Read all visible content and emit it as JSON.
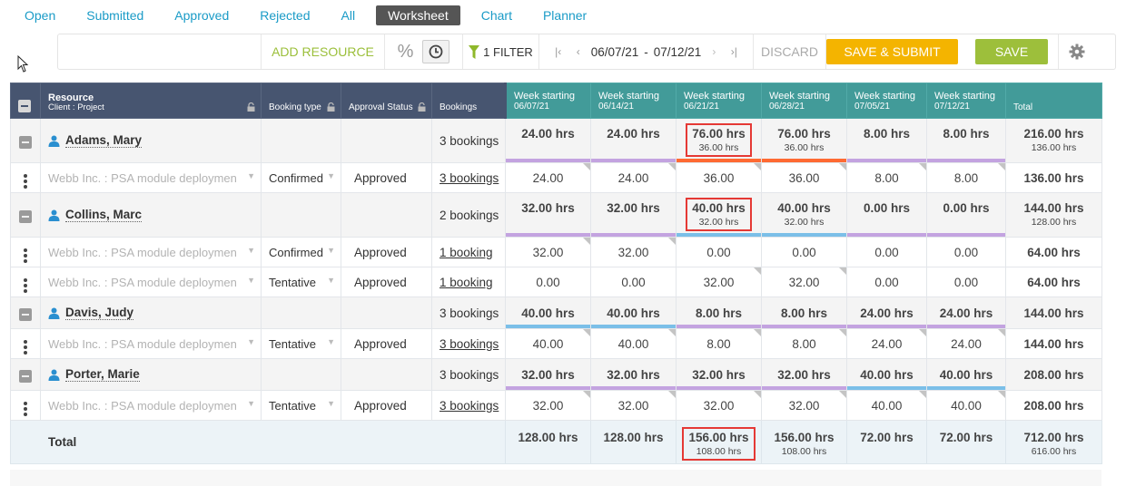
{
  "tabs": [
    {
      "label": "Open",
      "active": false
    },
    {
      "label": "Submitted",
      "active": false
    },
    {
      "label": "Approved",
      "active": false
    },
    {
      "label": "Rejected",
      "active": false
    },
    {
      "label": "All",
      "active": false
    },
    {
      "label": "Worksheet",
      "active": true
    },
    {
      "label": "Chart",
      "active": false
    },
    {
      "label": "Planner",
      "active": false
    }
  ],
  "toolbar": {
    "add_resource": "ADD RESOURCE",
    "percent_icon": "%",
    "clock_icon": "clock-icon",
    "filter_label": "1 FILTER",
    "date_from": "06/07/21",
    "date_sep": "-",
    "date_to": "07/12/21",
    "discard": "DISCARD",
    "save_submit": "SAVE & SUBMIT",
    "save": "SAVE",
    "settings_icon": "gear-icon"
  },
  "colors": {
    "header_dark": "#475570",
    "header_teal": "#429b99",
    "save_submit": "#f4b400",
    "save": "#9dbf3b",
    "bar_purple": "#c3a3e0",
    "bar_orange": "#ff6a33",
    "bar_blue": "#7bbfe8",
    "highlight": "#e53935"
  },
  "grid": {
    "headers": {
      "resource": "Resource",
      "client_project": "Client : Project",
      "booking_type": "Booking type",
      "approval_status": "Approval Status",
      "bookings": "Bookings",
      "week_label": "Week starting",
      "weeks": [
        "06/07/21",
        "06/14/21",
        "06/21/21",
        "06/28/21",
        "07/05/21",
        "07/12/21"
      ],
      "total": "Total"
    },
    "groups": [
      {
        "name": "Adams, Mary",
        "bookings": "3 bookings",
        "weeks": [
          {
            "value": "24.00 hrs",
            "sub": "",
            "bar": "purple"
          },
          {
            "value": "24.00 hrs",
            "sub": "",
            "bar": "purple"
          },
          {
            "value": "76.00 hrs",
            "sub": "36.00 hrs",
            "bar": "orange",
            "highlight": true
          },
          {
            "value": "76.00 hrs",
            "sub": "36.00 hrs",
            "bar": "orange"
          },
          {
            "value": "8.00 hrs",
            "sub": "",
            "bar": "purple"
          },
          {
            "value": "8.00 hrs",
            "sub": "",
            "bar": "purple"
          }
        ],
        "total": "216.00 hrs",
        "total_sub": "136.00 hrs",
        "rows": [
          {
            "project": "Webb Inc. : PSA module deploymen",
            "booking_type": "Confirmed",
            "approval": "Approved",
            "bookings": "3 bookings",
            "weeks": [
              "24.00",
              "24.00",
              "36.00",
              "36.00",
              "8.00",
              "8.00"
            ],
            "total": "136.00 hrs"
          }
        ]
      },
      {
        "name": "Collins, Marc",
        "bookings": "2 bookings",
        "weeks": [
          {
            "value": "32.00 hrs",
            "sub": "",
            "bar": "purple"
          },
          {
            "value": "32.00 hrs",
            "sub": "",
            "bar": "purple"
          },
          {
            "value": "40.00 hrs",
            "sub": "32.00 hrs",
            "bar": "blue",
            "highlight": true
          },
          {
            "value": "40.00 hrs",
            "sub": "32.00 hrs",
            "bar": "blue"
          },
          {
            "value": "0.00 hrs",
            "sub": "",
            "bar": "purple"
          },
          {
            "value": "0.00 hrs",
            "sub": "",
            "bar": "purple"
          }
        ],
        "total": "144.00 hrs",
        "total_sub": "128.00 hrs",
        "rows": [
          {
            "project": "Webb Inc. : PSA module deploymen",
            "booking_type": "Confirmed",
            "approval": "Approved",
            "bookings": "1 booking",
            "weeks": [
              "32.00",
              "32.00",
              "0.00",
              "0.00",
              "0.00",
              "0.00"
            ],
            "total": "64.00 hrs"
          },
          {
            "project": "Webb Inc. : PSA module deploymen",
            "booking_type": "Tentative",
            "approval": "Approved",
            "bookings": "1 booking",
            "weeks": [
              "0.00",
              "0.00",
              "32.00",
              "32.00",
              "0.00",
              "0.00"
            ],
            "total": "64.00 hrs"
          }
        ]
      },
      {
        "name": "Davis, Judy",
        "bookings": "3 bookings",
        "weeks": [
          {
            "value": "40.00 hrs",
            "sub": "",
            "bar": "blue"
          },
          {
            "value": "40.00 hrs",
            "sub": "",
            "bar": "blue"
          },
          {
            "value": "8.00 hrs",
            "sub": "",
            "bar": "purple"
          },
          {
            "value": "8.00 hrs",
            "sub": "",
            "bar": "purple"
          },
          {
            "value": "24.00 hrs",
            "sub": "",
            "bar": "purple"
          },
          {
            "value": "24.00 hrs",
            "sub": "",
            "bar": "purple"
          }
        ],
        "total": "144.00 hrs",
        "total_sub": "",
        "rows": [
          {
            "project": "Webb Inc. : PSA module deploymen",
            "booking_type": "Tentative",
            "approval": "Approved",
            "bookings": "3 bookings",
            "weeks": [
              "40.00",
              "40.00",
              "8.00",
              "8.00",
              "24.00",
              "24.00"
            ],
            "total": "144.00 hrs"
          }
        ]
      },
      {
        "name": "Porter, Marie",
        "bookings": "3 bookings",
        "weeks": [
          {
            "value": "32.00 hrs",
            "sub": "",
            "bar": "purple"
          },
          {
            "value": "32.00 hrs",
            "sub": "",
            "bar": "purple"
          },
          {
            "value": "32.00 hrs",
            "sub": "",
            "bar": "purple"
          },
          {
            "value": "32.00 hrs",
            "sub": "",
            "bar": "purple"
          },
          {
            "value": "40.00 hrs",
            "sub": "",
            "bar": "blue"
          },
          {
            "value": "40.00 hrs",
            "sub": "",
            "bar": "blue"
          }
        ],
        "total": "208.00 hrs",
        "total_sub": "",
        "rows": [
          {
            "project": "Webb Inc. : PSA module deploymen",
            "booking_type": "Tentative",
            "approval": "Approved",
            "bookings": "3 bookings",
            "weeks": [
              "32.00",
              "32.00",
              "32.00",
              "32.00",
              "40.00",
              "40.00"
            ],
            "total": "208.00 hrs"
          }
        ]
      }
    ],
    "totals": {
      "label": "Total",
      "weeks": [
        {
          "value": "128.00 hrs",
          "sub": ""
        },
        {
          "value": "128.00 hrs",
          "sub": ""
        },
        {
          "value": "156.00 hrs",
          "sub": "108.00 hrs",
          "highlight": true
        },
        {
          "value": "156.00 hrs",
          "sub": "108.00 hrs"
        },
        {
          "value": "72.00 hrs",
          "sub": ""
        },
        {
          "value": "72.00 hrs",
          "sub": ""
        }
      ],
      "total": "712.00 hrs",
      "total_sub": "616.00 hrs"
    }
  }
}
